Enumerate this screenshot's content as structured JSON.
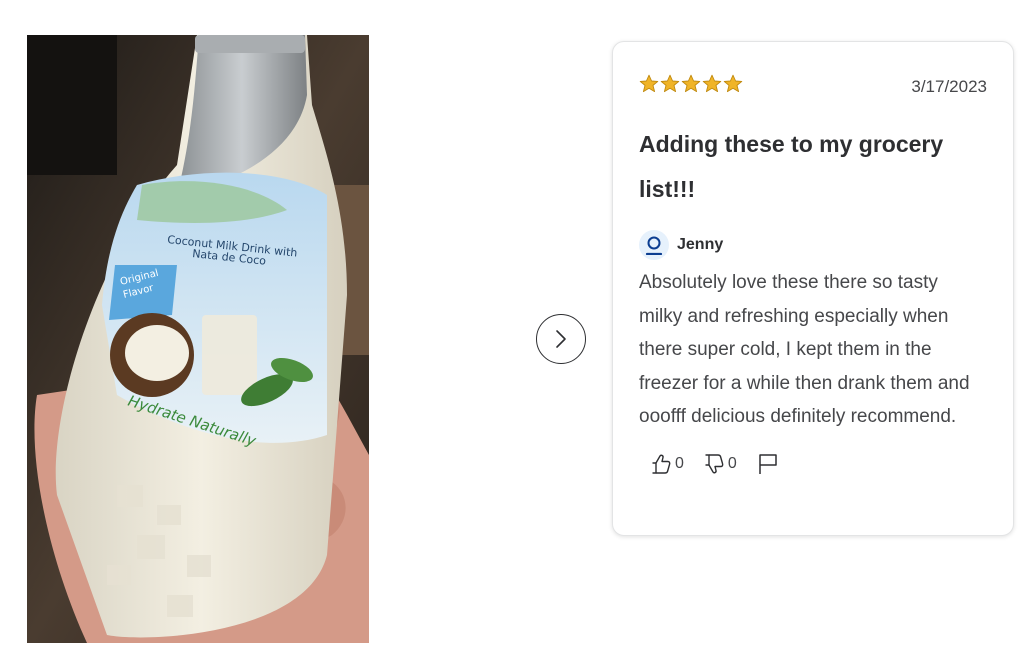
{
  "photo": {
    "alt": "Customer photo of coconut milk drink bottle",
    "label_lines": [
      "Coconut Milk Drink with",
      "Nata de Coco"
    ],
    "badge_lines": [
      "Original",
      "Flavor"
    ],
    "slogan": "Hydrate Naturally"
  },
  "review": {
    "rating": 5,
    "date": "3/17/2023",
    "title": "Adding these to my grocery list!!!",
    "author": "Jenny",
    "body": "Absolutely love these there so tasty milky and refreshing especially when there super cold, I kept them in the freezer for a while then drank them and ooofff delicious definitely recommend.",
    "helpful_count": "0",
    "not_helpful_count": "0"
  },
  "colors": {
    "star": "#f0b428",
    "text": "#2e2f32",
    "avatar_bg": "#e6f1fc",
    "avatar_icon": "#0b3d91"
  },
  "icons": {
    "next": "chevron-right-icon",
    "thumbs_up": "thumbs-up-icon",
    "thumbs_down": "thumbs-down-icon",
    "flag": "flag-icon",
    "user": "user-icon",
    "star": "star-icon"
  }
}
